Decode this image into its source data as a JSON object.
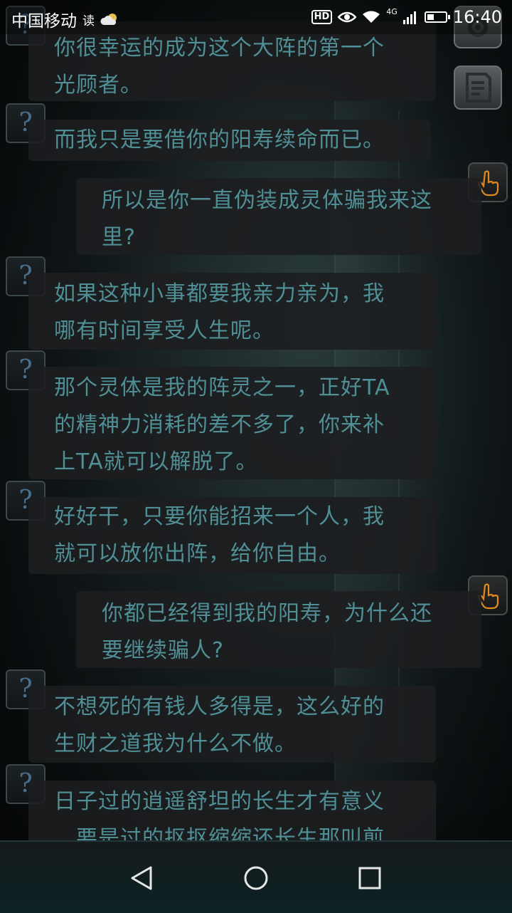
{
  "status_bar": {
    "carrier": "中国移动",
    "reader_label": "读",
    "hd": "HD",
    "network": "4G",
    "time": "16:40"
  },
  "messages": [
    {
      "side": "left",
      "lines": [
        "你很幸运的成为这个大阵的第一个",
        "光顾者。"
      ]
    },
    {
      "side": "left",
      "lines": [
        "而我只是要借你的阳寿续命而已。"
      ]
    },
    {
      "side": "right",
      "lines": [
        "所以是你一直伪装成灵体骗我来这",
        "里?"
      ]
    },
    {
      "side": "left",
      "lines": [
        "如果这种小事都要我亲力亲为，我",
        "哪有时间享受人生呢。"
      ]
    },
    {
      "side": "left",
      "lines": [
        "那个灵体是我的阵灵之一，正好TA",
        "的精神力消耗的差不多了，你来补",
        "上TA就可以解脱了。"
      ]
    },
    {
      "side": "left",
      "lines": [
        "好好干，只要你能招来一个人，我",
        "就可以放你出阵，给你自由。"
      ]
    },
    {
      "side": "right",
      "lines": [
        "你都已经得到我的阳寿，为什么还",
        "要继续骗人?"
      ]
    },
    {
      "side": "left",
      "lines": [
        "不想死的有钱人多得是，这么好的",
        "生财之道我为什么不做。"
      ]
    },
    {
      "side": "left",
      "lines": [
        "日子过的逍遥舒坦的长生才有意义",
        "，要是过的抠抠缩缩还长生那叫煎"
      ]
    }
  ],
  "avatar_unknown_symbol": "?",
  "icons": {
    "settings": "gear-icon",
    "notes": "notes-icon",
    "player": "hand-pointer-icon",
    "nav_back": "back-triangle-icon",
    "nav_home": "home-circle-icon",
    "nav_recent": "recent-square-icon"
  },
  "colors": {
    "message_text": "#4f8f95",
    "bubble_bg": "#1c1e20",
    "accent_orange": "#e08a1e"
  }
}
